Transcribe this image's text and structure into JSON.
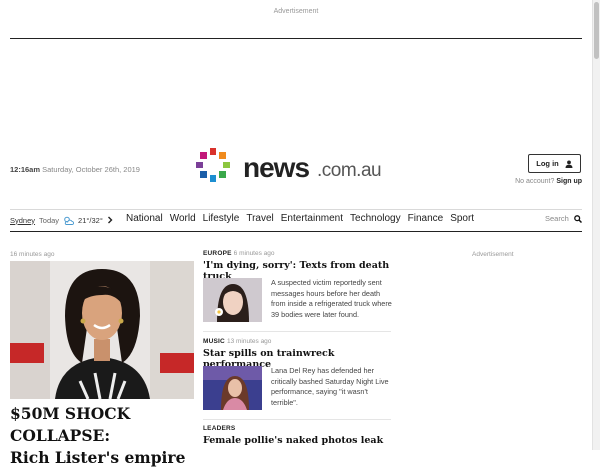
{
  "ad_top": "Advertisement",
  "header": {
    "time": "12:16am",
    "date": "Saturday, October 26th, 2019",
    "logo_main": "news",
    "logo_domain": ".com.au",
    "login_label": "Log in",
    "no_account": "No account?",
    "signup": "Sign up"
  },
  "nav": {
    "city": "Sydney",
    "today": "Today",
    "temps": "21°/32°",
    "links": [
      "National",
      "World",
      "Lifestyle",
      "Travel",
      "Entertainment",
      "Technology",
      "Finance",
      "Sport"
    ],
    "search": "Search"
  },
  "hero": {
    "time": "16 minutes ago",
    "title_line1": "$50M SHOCK COLLAPSE:",
    "title_line2": "Rich Lister's empire"
  },
  "articles": [
    {
      "category": "EUROPE",
      "ago": "6 minutes ago",
      "headline": "'I'm dying, sorry': Texts from death truck",
      "summary": "A suspected victim reportedly sent messages hours before her death from inside a refrigerated truck where 39 bodies were later found."
    },
    {
      "category": "MUSIC",
      "ago": "13 minutes ago",
      "headline": "Star spills on trainwreck performance",
      "summary": "Lana Del Rey has defended her critically bashed Saturday Night Live performance, saying \"it wasn't terrible\"."
    },
    {
      "category": "LEADERS",
      "ago": "",
      "headline": "Female pollie's naked photos leak",
      "summary": ""
    }
  ],
  "ad_right": "Advertisement",
  "colors": {
    "logo_dots": [
      "#d9322c",
      "#f08b1d",
      "#8cc63f",
      "#3aa84a",
      "#1d8fd1",
      "#1b5ea8",
      "#7b3f98",
      "#c2187a"
    ]
  }
}
